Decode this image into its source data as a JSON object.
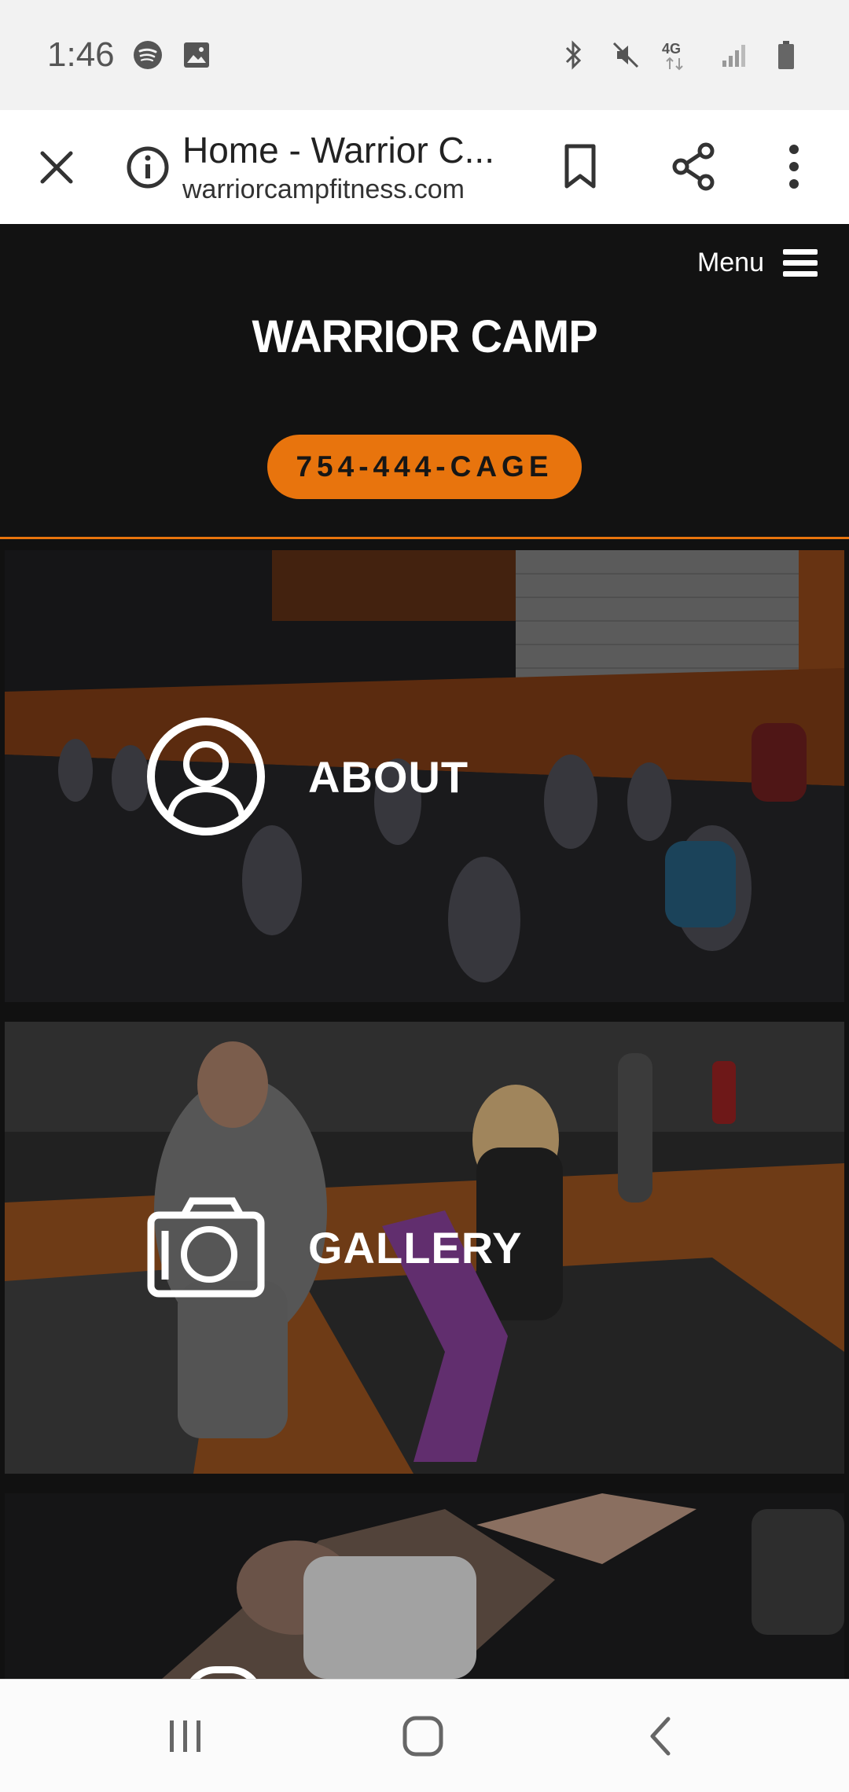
{
  "status_bar": {
    "time": "1:46",
    "left_icons": [
      "spotify-icon",
      "image-icon"
    ],
    "right_icons": [
      "bluetooth-icon",
      "mute-icon",
      "4g-lte-icon",
      "signal-icon",
      "battery-icon"
    ],
    "network_label": "4G"
  },
  "browser": {
    "page_title": "Home - Warrior C...",
    "url": "warriorcampfitness.com"
  },
  "site": {
    "menu_label": "Menu",
    "logo_text": "WARRIOR CAMP",
    "phone_button": "754-444-CAGE",
    "accent_color": "#e8740d"
  },
  "tiles": [
    {
      "label": "ABOUT",
      "icon": "user-profile-icon"
    },
    {
      "label": "GALLERY",
      "icon": "camera-icon"
    },
    {
      "label": "",
      "icon": "partially-visible-icon"
    }
  ],
  "nav_bar": {
    "buttons": [
      "recent-apps-icon",
      "home-icon",
      "back-icon"
    ]
  }
}
